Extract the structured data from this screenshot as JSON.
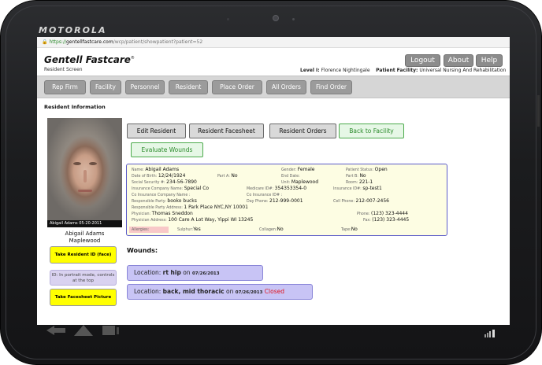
{
  "device": {
    "brand": "MOTOROLA"
  },
  "url": {
    "scheme": "https://",
    "host": "gentellfastcare.com",
    "path": "/wcp/patient/showpatient?patient=52"
  },
  "header": {
    "logo": "Gentell Fastcare",
    "logo_mark": "®",
    "subtitle": "Resident Screen",
    "logout": "Logout",
    "about": "About",
    "help": "Help",
    "level_label": "Level I:",
    "level_value": "Florence Nightingale",
    "facility_label": "Patient Facility:",
    "facility_value": "Universal Nursing And Rehabilitation"
  },
  "nav": [
    "Rep Firm",
    "Facility",
    "Personnel",
    "Resident",
    "Place Order",
    "All Orders",
    "Find Order"
  ],
  "section_title": "Resident Information",
  "photo": {
    "caption": "Abigail Adams 05-20-2011"
  },
  "patient": {
    "name_line": "Abigail Adams",
    "unit_line": "Maplewood"
  },
  "actions": {
    "edit": "Edit Resident",
    "facesheet": "Resident Facesheet",
    "orders": "Resident Orders",
    "back": "Back to Facility",
    "evaluate": "Evaluate Wounds"
  },
  "side": {
    "take_id": "Take Resident ID (face)",
    "note": "ID: In portrait mode, controls at the top",
    "take_facesheet": "Take Facesheet Picture"
  },
  "info": {
    "name_l": "Name:",
    "name": "Abigail Adams",
    "gender_l": "Gender:",
    "gender": "Female",
    "status_l": "Patient Status:",
    "status": "Open",
    "dob_l": "Date of Birth:",
    "dob": "12/24/1924",
    "parta_l": "Part A:",
    "parta": "No",
    "enddate_l": "End Date:",
    "enddate": "",
    "partb_l": "Part B:",
    "partb": "No",
    "ssn_l": "Social Security #:",
    "ssn": "234-56-7890",
    "unit_l": "Unit:",
    "unit": "Maplewood",
    "room_l": "Room:",
    "room": "221-1",
    "ins_l": "Insurance Company Name:",
    "ins": "Special Co",
    "medicare_l": "Medicare ID#:",
    "medicare": "354353354-0",
    "insid_l": "Insurance ID#:",
    "insid": "sp-test1",
    "coins_l": "Co Insurance Company Name :",
    "coins": "",
    "coinsid_l": "Co Insurance ID# :",
    "coinsid": "",
    "resp_l": "Responsible Party:",
    "resp": "booko bucks",
    "dayphone_l": "Day Phone:",
    "dayphone": "212-999-0001",
    "cell_l": "Cell Phone:",
    "cell": "212-007-2456",
    "respaddr_l": "Responsible Party Address:",
    "respaddr": "1 Park Place NYC,NY 10001",
    "phys_l": "Physician:",
    "phys": "Thomas Sneddon",
    "phone_l": "Phone:",
    "phone": "(123) 323-4444",
    "physaddr_l": "Physician Address:",
    "physaddr": "100 Care A Lot Way, Yippi WI 13245",
    "fax_l": "Fax:",
    "fax": "(123) 323-4445",
    "allergies_l": "Allergies:",
    "allergies": "",
    "sulphur_l": "Sulphur:",
    "sulphur": "Yes",
    "collagen_l": "Collagen:",
    "collagen": "No",
    "tape_l": "Tape:",
    "tape": "No"
  },
  "wounds": {
    "title": "Wounds:",
    "items": [
      {
        "prefix": "Location:",
        "location": "rt hip",
        "on": "on",
        "date": "07/26/2013",
        "status": ""
      },
      {
        "prefix": "Location:",
        "location": "back, mid thoracic",
        "on": "on",
        "date": "07/26/2013",
        "status": "Closed"
      }
    ]
  },
  "colors": {
    "closed": "#e0141e",
    "nav_button": "#9b9b9b",
    "wound_box": "#c8c4f5",
    "yellow": "#ffff00"
  }
}
